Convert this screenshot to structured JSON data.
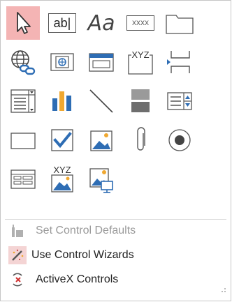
{
  "controls_grid": {
    "rows": [
      [
        "select-pointer",
        "text-box",
        "label",
        "button",
        "tab-control"
      ],
      [
        "hyperlink",
        "web-browser-control",
        "navigation-control",
        "option-group",
        "page-break"
      ],
      [
        "combo-box",
        "chart",
        "line",
        "toggle-button",
        "list-box"
      ],
      [
        "rectangle",
        "check-box",
        "unbound-object-frame",
        "attachment",
        "option-button"
      ],
      [
        "subform-subreport",
        "bound-object-frame",
        "image"
      ]
    ],
    "text_box_glyph": "ab|",
    "label_glyph": "Aa",
    "button_glyph": "XXXX",
    "xyz_glyph": "XYZ"
  },
  "menu": {
    "set_defaults": "Set Control Defaults",
    "use_wizards": "Use Control Wizards",
    "activex": "ActiveX Controls"
  },
  "colors": {
    "selected_bg": "#f4b4b4",
    "accent_blue": "#2e6db4",
    "disabled_text": "#9a9a9a"
  }
}
